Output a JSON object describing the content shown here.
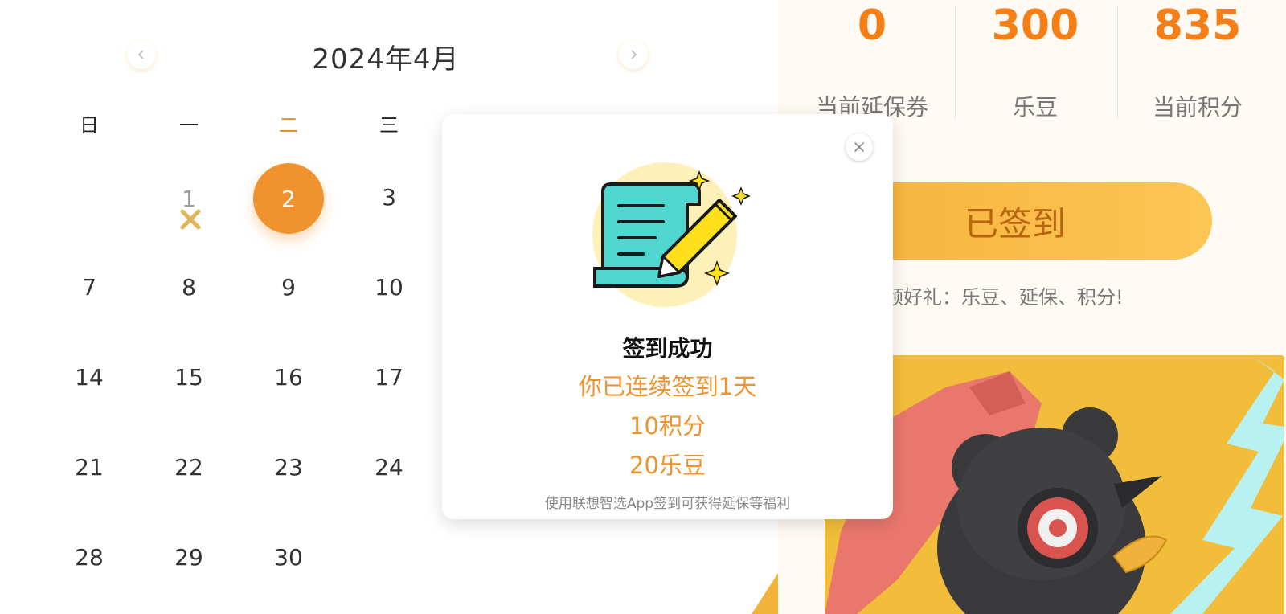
{
  "calendar": {
    "title": "2024年4月",
    "prev_icon": "chevron-left-icon",
    "next_icon": "chevron-right-icon",
    "weekdays": [
      "日",
      "一",
      "二",
      "三"
    ],
    "today_weekday_index": 2,
    "days": [
      {
        "label": "1",
        "status": "missed"
      },
      {
        "label": "2",
        "status": "signed-today"
      },
      {
        "label": "3"
      },
      {
        "label": "7"
      },
      {
        "label": "8"
      },
      {
        "label": "9"
      },
      {
        "label": "10"
      },
      {
        "label": "14"
      },
      {
        "label": "15"
      },
      {
        "label": "16"
      },
      {
        "label": "17"
      },
      {
        "label": "21"
      },
      {
        "label": "22"
      },
      {
        "label": "23"
      },
      {
        "label": "24"
      },
      {
        "label": "28"
      },
      {
        "label": "29"
      },
      {
        "label": "30"
      }
    ],
    "missed_icon": "cross-icon"
  },
  "stats": [
    {
      "value": "0",
      "label": "当前延保券"
    },
    {
      "value": "300",
      "label": "乐豆"
    },
    {
      "value": "835",
      "label": "当前积分"
    }
  ],
  "signin": {
    "button_label": "已签到",
    "tip": "签到可领好礼：乐豆、延保、积分!"
  },
  "modal": {
    "title": "签到成功",
    "streak": "你已连续签到1天",
    "points": "10积分",
    "beans": "20乐豆",
    "footer": "使用联想智选App签到可获得延保等福利",
    "illustration_icon": "scroll-pencil-icon",
    "close_icon": "close-icon"
  },
  "colors": {
    "accent": "#f0922e",
    "stat_value": "#f57f17",
    "button": "#f7b23a"
  }
}
